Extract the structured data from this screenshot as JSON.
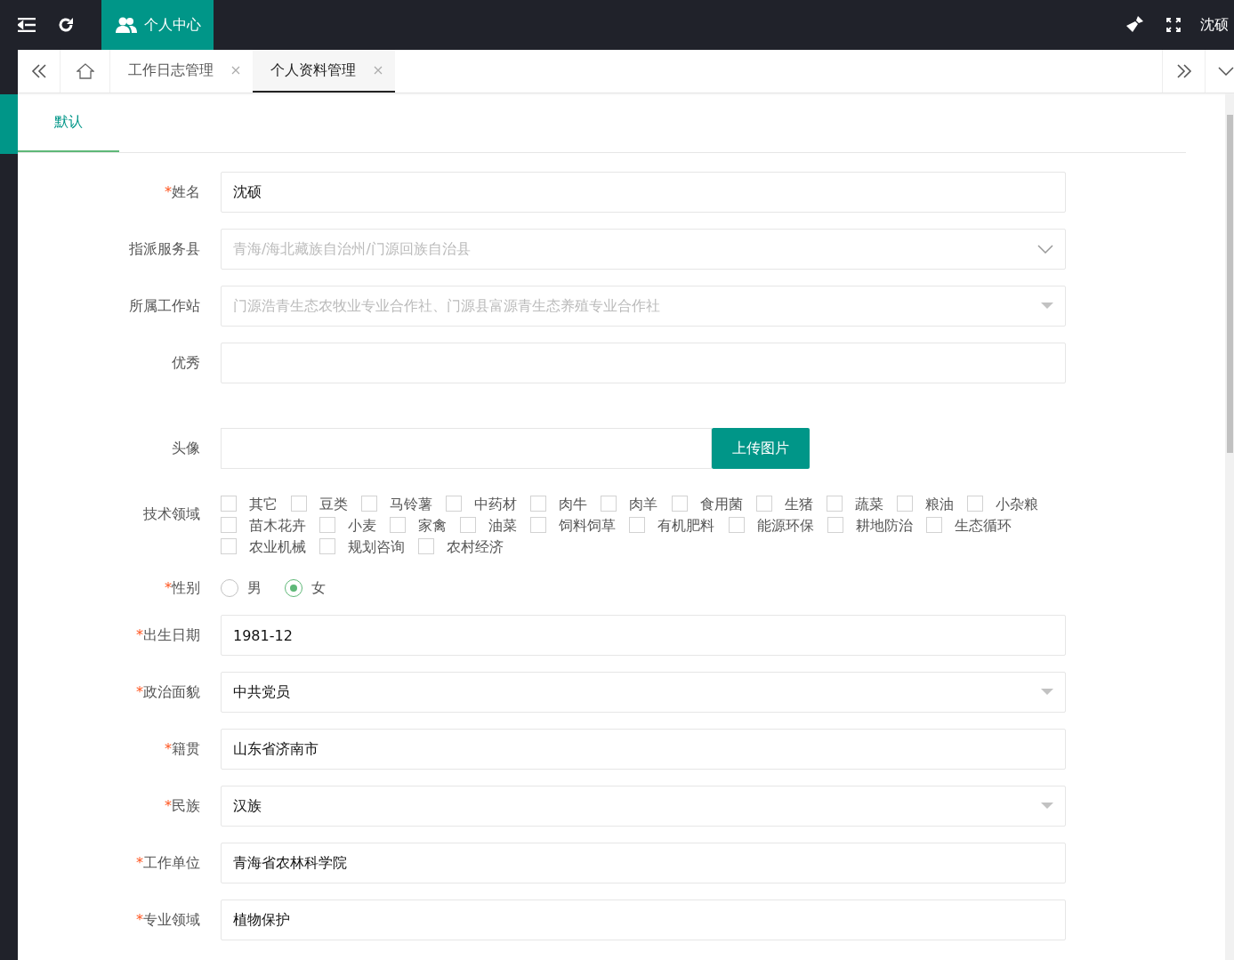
{
  "header": {
    "active_module": "个人中心",
    "user": "沈硕"
  },
  "tabs": [
    {
      "label": "工作日志管理",
      "selected": false
    },
    {
      "label": "个人资料管理",
      "selected": true
    }
  ],
  "subtabs": [
    {
      "label": "默认",
      "selected": true
    }
  ],
  "fields": [
    {
      "kind": "text",
      "label": "姓名",
      "required_mark": "*",
      "value": "沈硕"
    },
    {
      "kind": "cascader",
      "label": "指派服务县",
      "placeholder": "青海/海北藏族自治州/门源回族自治县"
    },
    {
      "kind": "select",
      "label": "所属工作站",
      "placeholder": "门源浩青生态农牧业专业合作社、门源县富源青生态养殖专业合作社"
    },
    {
      "kind": "text",
      "label": "优秀"
    },
    {
      "kind": "upload",
      "label": "头像",
      "button": "上传图片"
    },
    {
      "kind": "checkboxes",
      "label": "技术领域",
      "options": [
        {
          "label": "其它",
          "checked": false
        },
        {
          "label": "豆类",
          "checked": false
        },
        {
          "label": "马铃薯",
          "checked": false
        },
        {
          "label": "中药材",
          "checked": false
        },
        {
          "label": "肉牛",
          "checked": false
        },
        {
          "label": "肉羊",
          "checked": false
        },
        {
          "label": "食用菌",
          "checked": false
        },
        {
          "label": "生猪",
          "checked": false
        },
        {
          "label": "蔬菜",
          "checked": false
        },
        {
          "label": "粮油",
          "checked": false
        },
        {
          "label": "小杂粮",
          "checked": false
        },
        {
          "label": "苗木花卉",
          "checked": false
        },
        {
          "label": "小麦",
          "checked": false
        },
        {
          "label": "家禽",
          "checked": false
        },
        {
          "label": "油菜",
          "checked": false
        },
        {
          "label": "饲料饲草",
          "checked": false
        },
        {
          "label": "有机肥料",
          "checked": false
        },
        {
          "label": "能源环保",
          "checked": false
        },
        {
          "label": "耕地防治",
          "checked": false
        },
        {
          "label": "生态循环",
          "checked": false
        },
        {
          "label": "农业机械",
          "checked": false
        },
        {
          "label": "规划咨询",
          "checked": false
        },
        {
          "label": "农村经济",
          "checked": false
        }
      ]
    },
    {
      "kind": "radio",
      "label": "性别",
      "required_mark": "*",
      "options": [
        {
          "label": "男",
          "selected": false
        },
        {
          "label": "女",
          "selected": true
        }
      ]
    },
    {
      "kind": "text",
      "label": "出生日期",
      "required_mark": "*",
      "value": "1981-12"
    },
    {
      "kind": "select",
      "label": "政治面貌",
      "required_mark": "*",
      "value": "中共党员"
    },
    {
      "kind": "text",
      "label": "籍贯",
      "required_mark": "*",
      "value": "山东省济南市"
    },
    {
      "kind": "select",
      "label": "民族",
      "required_mark": "*",
      "value": "汉族"
    },
    {
      "kind": "text",
      "label": "工作单位",
      "required_mark": "*",
      "value": "青海省农林科学院"
    },
    {
      "kind": "text",
      "label": "专业领域",
      "required_mark": "*",
      "value": "植物保护"
    }
  ]
}
